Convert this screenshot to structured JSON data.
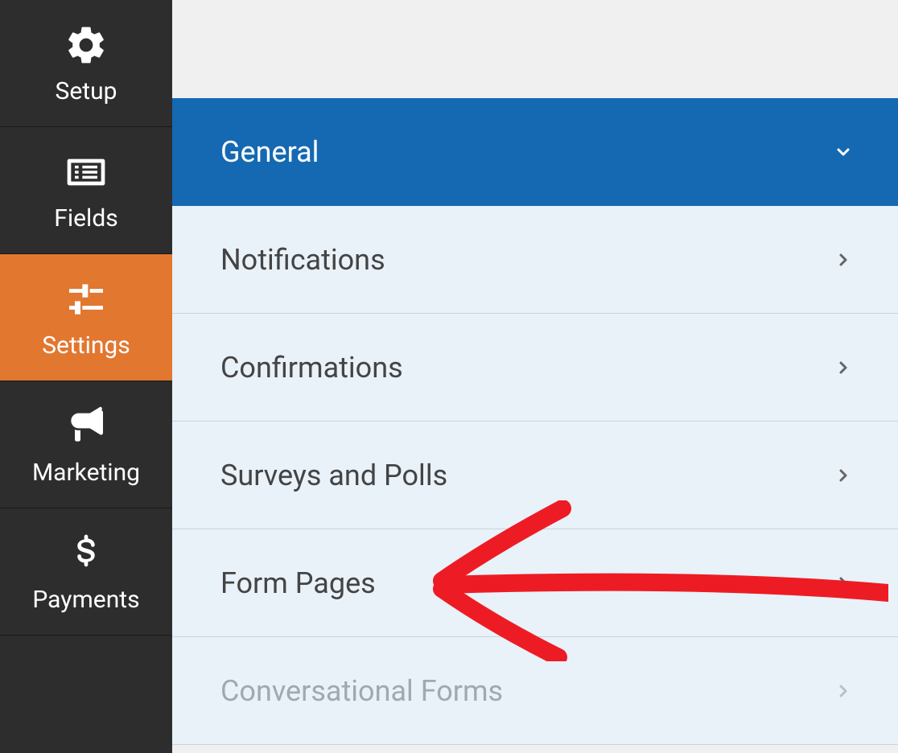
{
  "sidebar": {
    "items": [
      {
        "label": "Setup",
        "icon": "gear-icon"
      },
      {
        "label": "Fields",
        "icon": "list-icon"
      },
      {
        "label": "Settings",
        "icon": "sliders-icon"
      },
      {
        "label": "Marketing",
        "icon": "bullhorn-icon"
      },
      {
        "label": "Payments",
        "icon": "dollar-icon"
      }
    ],
    "active_index": 2
  },
  "settings": {
    "items": [
      {
        "label": "General",
        "expanded": true
      },
      {
        "label": "Notifications",
        "expanded": false
      },
      {
        "label": "Confirmations",
        "expanded": false
      },
      {
        "label": "Surveys and Polls",
        "expanded": false
      },
      {
        "label": "Form Pages",
        "expanded": false
      },
      {
        "label": "Conversational Forms",
        "expanded": false,
        "disabled": true
      }
    ]
  },
  "annotation": {
    "target": "Form Pages",
    "color": "#ed1c24"
  }
}
